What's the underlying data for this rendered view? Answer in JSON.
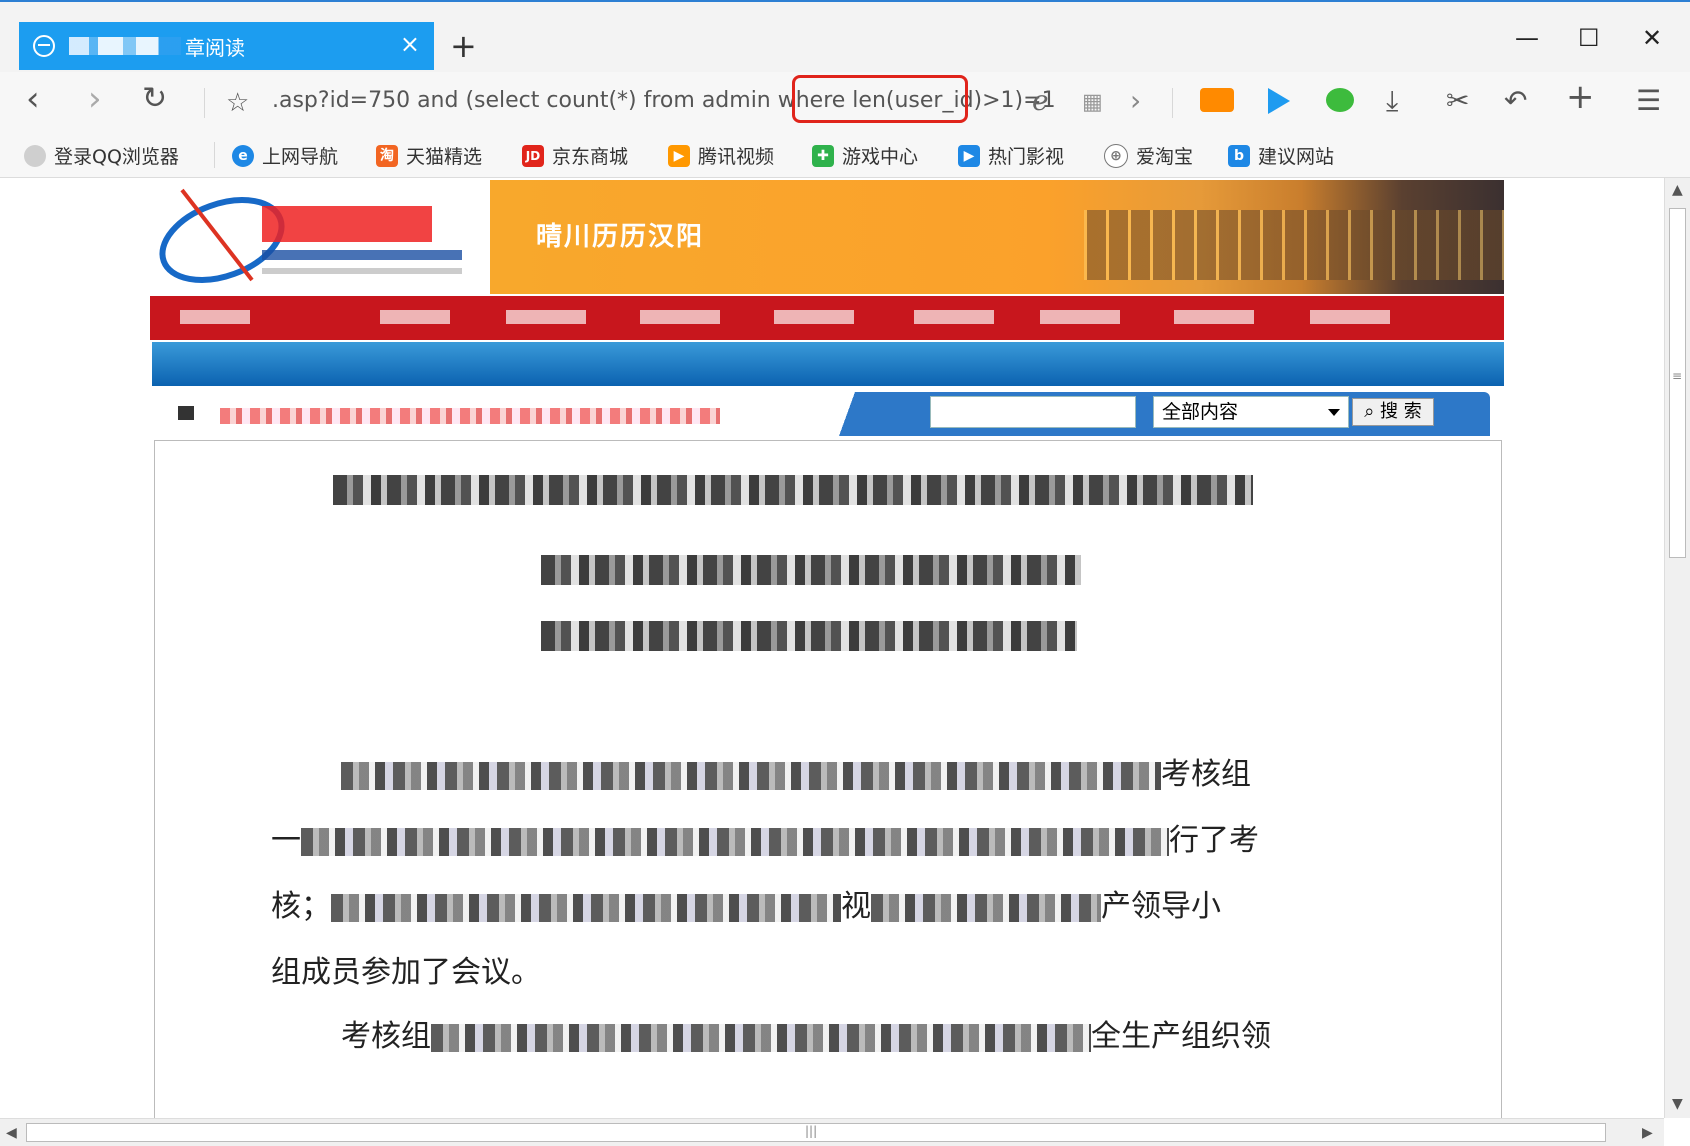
{
  "tab": {
    "title": "章阅读",
    "close": "×"
  },
  "new_tab": "+",
  "window": {
    "minimize": "—",
    "maximize": "☐",
    "close": "✕"
  },
  "toolbar": {
    "back": "‹",
    "forward": "›",
    "reload": "↻",
    "star": "☆",
    "url": ".asp?id=750 and (select count(*) from admin where len(user_id)>1)=1",
    "ie_icon": "ℯ",
    "qr_icon": "▦",
    "more": "›",
    "download": "⤓",
    "cut": "✂",
    "undo": "↶",
    "add": "+",
    "menu": "☰"
  },
  "bookmarks": [
    {
      "label": "登录QQ浏览器",
      "icon": "user-icon",
      "color": "#cfcfcf"
    },
    {
      "label": "上网导航",
      "icon": "ie-icon",
      "color": "#1e88e5"
    },
    {
      "label": "天猫精选",
      "icon": "tmall-icon",
      "color": "#f26522"
    },
    {
      "label": "京东商城",
      "icon": "jd-icon",
      "color": "#e1251b"
    },
    {
      "label": "腾讯视频",
      "icon": "video-icon",
      "color": "#ff9800"
    },
    {
      "label": "游戏中心",
      "icon": "gamepad-icon",
      "color": "#2fb24c"
    },
    {
      "label": "热门影视",
      "icon": "play-icon",
      "color": "#1e88e5"
    },
    {
      "label": "爱淘宝",
      "icon": "globe-icon",
      "color": "#777777"
    },
    {
      "label": "建议网站",
      "icon": "bing-icon",
      "color": "#1e88e5"
    }
  ],
  "site": {
    "slogan": "晴川历历汉阳",
    "search_select": "全部内容",
    "search_button": "搜 索"
  },
  "article": {
    "p1_end": "考核组",
    "p2_start": "一",
    "p2_end": "行了考",
    "p3_start": "核；",
    "p3_mid": "视",
    "p3_end": "产领导小",
    "p4": "组成员参加了会议。",
    "p5_start": "考核组",
    "p5_end": "全生产组织领"
  },
  "scrollbar": {
    "grip": "≡",
    "h_grip": "|||"
  }
}
